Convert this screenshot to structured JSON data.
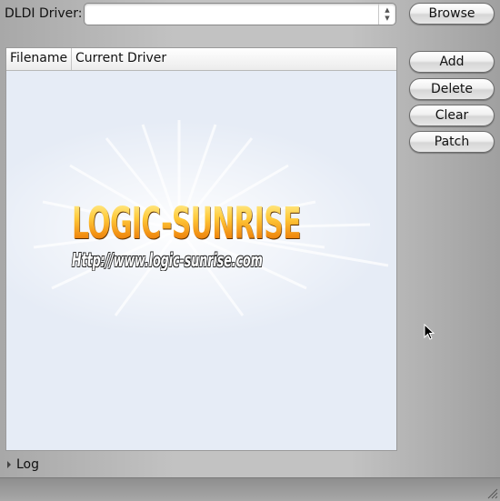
{
  "driver": {
    "label": "DLDI Driver:",
    "value": "",
    "placeholder": ""
  },
  "buttons": {
    "browse": "Browse",
    "add": "Add",
    "delete": "Delete",
    "clear": "Clear",
    "patch": "Patch"
  },
  "table": {
    "columns": [
      "Filename",
      "Current Driver"
    ],
    "rows": []
  },
  "watermark": {
    "logo_text": "LOGIC-SUNRISE",
    "url_text": "Http://www.logic-sunrise.com"
  },
  "log": {
    "label": "Log",
    "expanded": false
  },
  "icons": {
    "spin": "spin-arrows-icon",
    "expander": "expander-triangle-icon",
    "grip": "resize-grip-icon",
    "cursor": "mouse-pointer-icon"
  }
}
